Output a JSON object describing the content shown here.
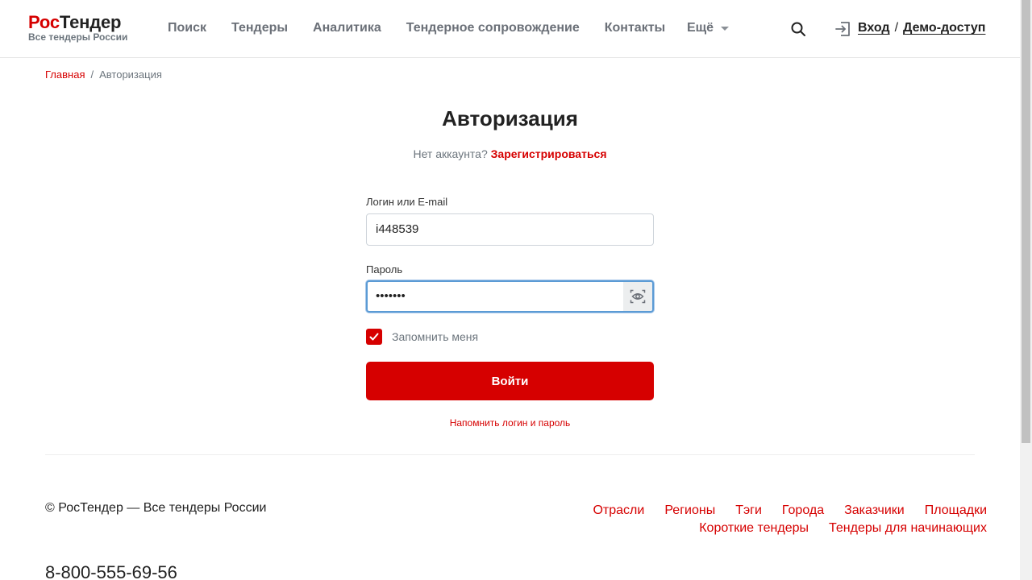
{
  "header": {
    "logo": {
      "part1": "Рос",
      "part2": "Тендер",
      "tagline": "Все тендеры России"
    },
    "nav": [
      {
        "label": "Поиск"
      },
      {
        "label": "Тендеры"
      },
      {
        "label": "Аналитика"
      },
      {
        "label": "Тендерное сопровождение"
      },
      {
        "label": "Контакты"
      }
    ],
    "more_label": "Ещё",
    "login_label": "Вход",
    "separator": "/",
    "demo_label": "Демо-доступ"
  },
  "breadcrumb": {
    "home": "Главная",
    "separator": "/",
    "current": "Авторизация"
  },
  "form": {
    "title": "Авторизация",
    "no_account_text": "Нет аккаунта?",
    "register_label": "Зарегистрироваться",
    "login_label": "Логин или E-mail",
    "login_value": "i448539",
    "password_label": "Пароль",
    "password_value": "•••••••",
    "remember_label": "Запомнить меня",
    "remember_checked": true,
    "submit_label": "Войти",
    "remind_label": "Напомнить логин и пароль"
  },
  "footer": {
    "copyright": "© РосТендер — Все тендеры России",
    "links_row1": [
      "Отрасли",
      "Регионы",
      "Тэги",
      "Города",
      "Заказчики",
      "Площадки"
    ],
    "links_row2": [
      "Короткие тендеры",
      "Тендеры для начинающих"
    ],
    "phone": "8-800-555-69-56"
  },
  "colors": {
    "accent": "#d60000",
    "text": "#222222",
    "muted": "#6c757d",
    "focus": "#5b9bd5"
  }
}
